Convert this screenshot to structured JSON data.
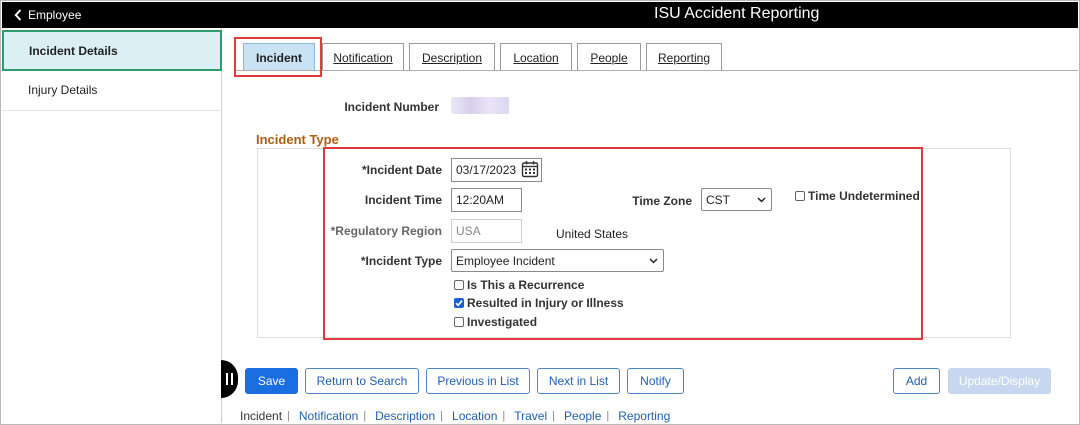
{
  "header": {
    "back_label": "Employee",
    "title": "ISU Accident Reporting"
  },
  "sidebar": {
    "items": [
      {
        "label": "Incident Details",
        "active": true
      },
      {
        "label": "Injury Details",
        "active": false
      }
    ]
  },
  "tabs": [
    {
      "label": "Incident",
      "active": true
    },
    {
      "label": "Notification",
      "active": false
    },
    {
      "label": "Description",
      "active": false
    },
    {
      "label": "Location",
      "active": false
    },
    {
      "label": "People",
      "active": false
    },
    {
      "label": "Reporting",
      "active": false
    }
  ],
  "form": {
    "incident_number_label": "Incident Number",
    "section_title": "Incident Type",
    "incident_date_label": "*Incident Date",
    "incident_date_value": "03/17/2023",
    "incident_time_label": "Incident Time",
    "incident_time_value": "12:20AM",
    "time_zone_label": "Time Zone",
    "time_zone_value": "CST",
    "time_undetermined_label": "Time Undetermined",
    "time_undetermined_checked": false,
    "regulatory_region_label": "*Regulatory Region",
    "regulatory_region_value": "USA",
    "regulatory_region_desc": "United States",
    "incident_type_label": "*Incident Type",
    "incident_type_value": "Employee Incident",
    "checkboxes": [
      {
        "label": "Is This a Recurrence",
        "checked": false
      },
      {
        "label": "Resulted in Injury or Illness",
        "checked": true
      },
      {
        "label": "Investigated",
        "checked": false
      }
    ]
  },
  "toolbar": {
    "save": "Save",
    "return_to_search": "Return to Search",
    "previous_in_list": "Previous in List",
    "next_in_list": "Next in List",
    "notify": "Notify",
    "add": "Add",
    "update_display": "Update/Display"
  },
  "bottom_links": {
    "current": "Incident",
    "links": [
      "Notification",
      "Description",
      "Location",
      "Travel",
      "People",
      "Reporting"
    ]
  },
  "colors": {
    "highlight_red": "#e03a3a",
    "section_title": "#b15e10",
    "primary_blue": "#1a6ee0",
    "active_tab": "#c9e3f5",
    "active_nav": "#daf0f5",
    "active_nav_border": "#2f9a6c"
  }
}
